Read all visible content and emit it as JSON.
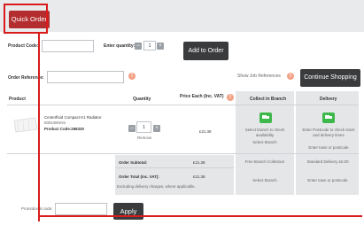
{
  "tab": {
    "label": "Quick Order"
  },
  "form": {
    "product_code_label": "Product Code:",
    "quantity_label": "Enter quantity:",
    "quantity_value": "1",
    "add_button": "Add to Order",
    "order_ref_label": "Order Reference:",
    "show_job_refs": "Show Job References",
    "continue_button": "Continue Shopping"
  },
  "table": {
    "headers": {
      "product": "Product",
      "quantity": "Quantity",
      "price": "Price Each (Inc. VAT)",
      "collect": "Collect in Branch",
      "delivery": "Delivery"
    },
    "row": {
      "name": "Centerfloid Compact K1 Radiator",
      "sub": "500x400mm",
      "code": "Product Code:268330",
      "qty": "1",
      "remove": "Remove",
      "price": "£21.38",
      "collect_text": "Select branch to check availability",
      "collect_link": "Select Branch",
      "delivery_text": "Enter Postcode to check stock and delivery times",
      "delivery_link": "Enter town or postcode"
    },
    "summary": {
      "subtotal_label": "Order Subtotal:",
      "subtotal_value": "£21.38",
      "total_label": "Order Total (Inc. VAT):",
      "total_value": "£21.38",
      "note": "Excluding delivery charges, where applicable.",
      "free_collection": "Free Branch Collection",
      "standard_delivery": "Standard Delivery £6.00",
      "select_branch": "Select Branch",
      "enter_town": "Enter town or postcode"
    }
  },
  "promo": {
    "label": "Promotional code:",
    "apply": "Apply"
  }
}
